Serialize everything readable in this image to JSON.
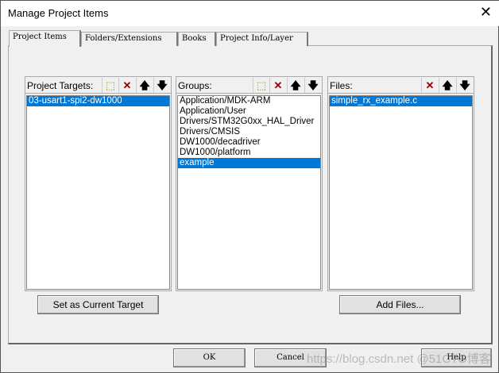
{
  "window": {
    "title": "Manage Project Items",
    "close": "✕"
  },
  "tabs": [
    "Project Items",
    "Folders/Extensions",
    "Books",
    "Project Info/Layer"
  ],
  "targets": {
    "label": "Project Targets:",
    "items": [
      "03-usart1-spi2-dw1000"
    ],
    "selected": 0
  },
  "groups": {
    "label": "Groups:",
    "items": [
      "Application/MDK-ARM",
      "Application/User",
      "Drivers/STM32G0xx_HAL_Driver",
      "Drivers/CMSIS",
      "DW1000/decadriver",
      "DW1000/platform",
      "example"
    ],
    "selected": 6
  },
  "files": {
    "label": "Files:",
    "items": [
      "simple_rx_example.c"
    ],
    "selected": 0
  },
  "icons": {
    "new": "⬚",
    "delete": "✕",
    "up": "🡅",
    "down": "🡇"
  },
  "buttons": {
    "set_target": "Set as Current Target",
    "add_files": "Add Files...",
    "ok": "OK",
    "cancel": "Cancel",
    "help": "Help"
  },
  "watermark": "https://blog.csdn.net @51CTO博客"
}
